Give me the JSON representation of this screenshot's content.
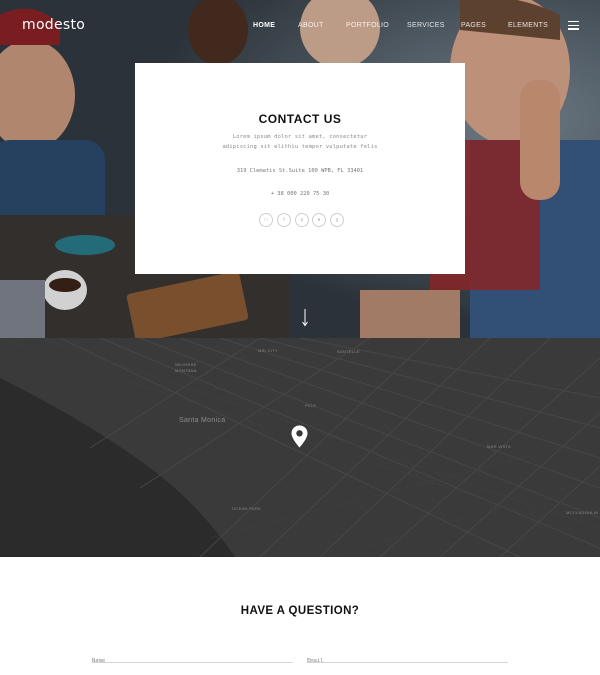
{
  "header": {
    "logo": "modesto",
    "nav": [
      {
        "label": "HOME",
        "active": true
      },
      {
        "label": "ABOUT",
        "active": false
      },
      {
        "label": "PORTFOLIO",
        "active": false
      },
      {
        "label": "SERVICES",
        "active": false
      },
      {
        "label": "PAGES",
        "active": false
      },
      {
        "label": "ELEMENTS",
        "active": false
      }
    ],
    "menu_icon": "hamburger-icon"
  },
  "contact": {
    "title": "CONTACT US",
    "text_line1": "Lorem ipsum dolor sit amet, consectetur",
    "text_line2": "adipiscing sit elithiu tempor vulputate felis",
    "address": "319 Clematis St.Suite 100 WPB, FL 33401",
    "phone": "+ 38 000 220 75 30",
    "socials": [
      "instagram-icon",
      "facebook-icon",
      "pinterest-icon",
      "twitter-icon",
      "google-plus-icon"
    ]
  },
  "scroll_icon": "arrow-down-icon",
  "map": {
    "labels": {
      "santa_monica": "Santa Monica",
      "mid_city": "MID CITY",
      "santelle": "SANTELLE",
      "wilshire_montana": "WILSHIRE",
      "montana": "MONTANA",
      "pico": "PICO",
      "mar_vista": "MAR VISTA",
      "ocean_park": "OCEAN PARK",
      "mcclaughlin": "MCCLAUGHLIN"
    },
    "pin_icon": "map-pin-icon",
    "colors": {
      "land": "#3a3a3a",
      "water": "#2a2a2a",
      "roads": "#4a4a4a"
    }
  },
  "question": {
    "title": "HAVE A QUESTION?",
    "name_placeholder": "Name",
    "email_placeholder": "Email"
  }
}
